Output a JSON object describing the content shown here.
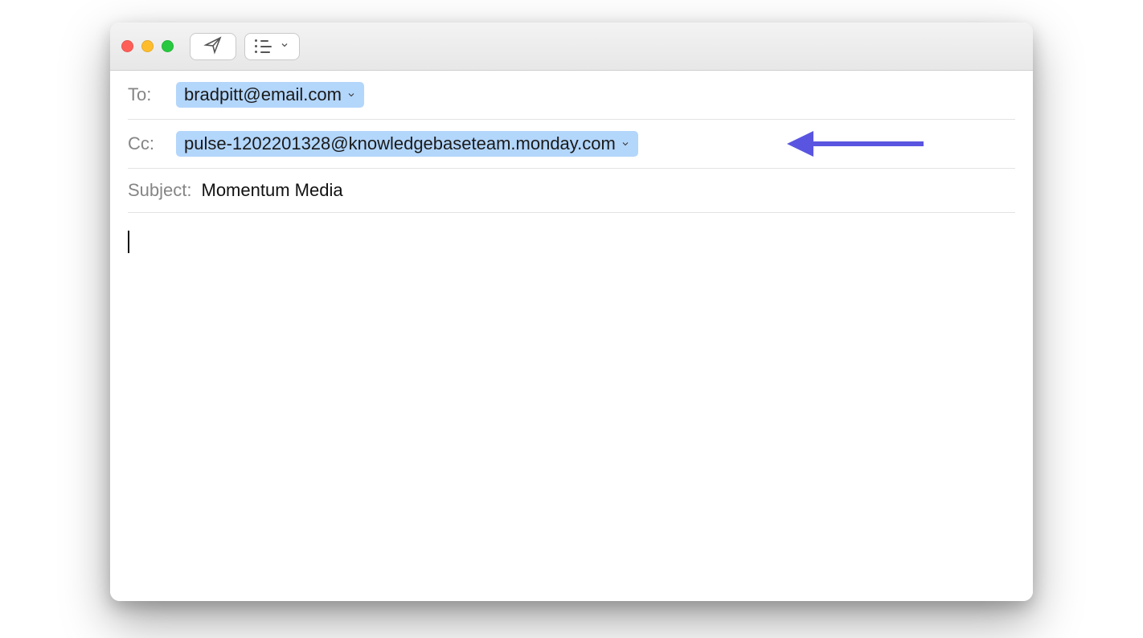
{
  "fields": {
    "to": {
      "label": "To:",
      "recipient": "bradpitt@email.com"
    },
    "cc": {
      "label": "Cc:",
      "recipient": "pulse-1202201328@knowledgebaseteam.monday.com"
    },
    "subject": {
      "label": "Subject:",
      "value": "Momentum Media"
    }
  },
  "annotation": {
    "arrow_color": "#5a55e0"
  }
}
